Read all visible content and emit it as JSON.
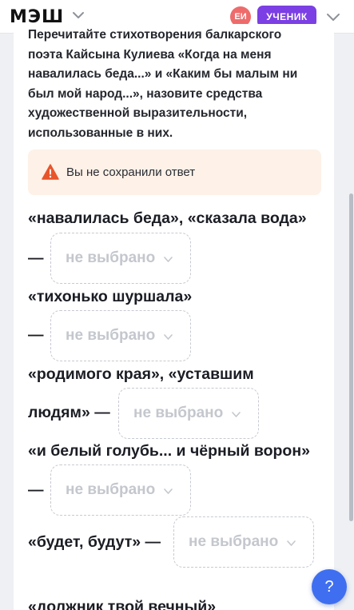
{
  "header": {
    "logo": "МЭШ",
    "avatar_initials": "ЕИ",
    "role_label": "УЧЕНИК"
  },
  "task": {
    "prompt_lines": [
      "Перечитайте стихотворения балкарского",
      "поэта Кайсына Кулиева «Когда на меня",
      "навалилась беда...» и «Каким бы малым ни",
      "был мой народ...», назовите средства",
      "художественной выразительности,",
      "использованные в них."
    ]
  },
  "alert": {
    "text": "Вы не сохранили ответ"
  },
  "dash": "—",
  "rows": [
    {
      "text": "«навалилась беда», «сказала вода»",
      "select": "не выбрано"
    },
    {
      "text": "«тихонько шуршала»",
      "select": "не выбрано"
    },
    {
      "text": "«родимого края», «уставшим",
      "text2": "людям» —",
      "select": "не выбрано"
    },
    {
      "text": "«и белый голубь... и чёрный ворон»",
      "select": "не выбрано"
    },
    {
      "text": "«будет, будут» —",
      "select": "не выбрано"
    },
    {
      "text": "«должник твой вечный»"
    }
  ],
  "help": {
    "label": "?"
  },
  "colors": {
    "accent": "#7b3fe4",
    "help": "#3f6ff0",
    "alert_bg": "#fdf1e8",
    "warning": "#e8552b"
  }
}
